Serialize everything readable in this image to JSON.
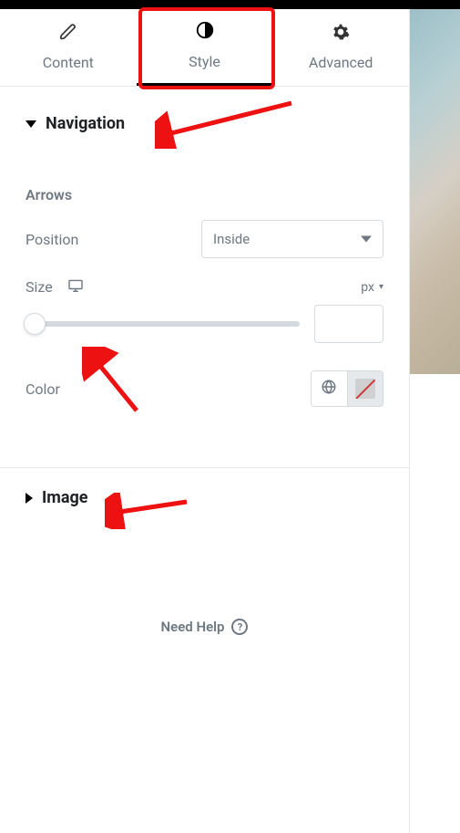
{
  "tabs": {
    "content": {
      "label": "Content"
    },
    "style": {
      "label": "Style",
      "active": true
    },
    "advanced": {
      "label": "Advanced"
    }
  },
  "sections": {
    "navigation": {
      "title": "Navigation",
      "expanded": true,
      "arrows": {
        "heading": "Arrows",
        "position": {
          "label": "Position",
          "value": "Inside"
        },
        "size": {
          "label": "Size",
          "unit": "px",
          "value": ""
        },
        "color": {
          "label": "Color"
        }
      }
    },
    "image": {
      "title": "Image",
      "expanded": false
    }
  },
  "help": {
    "label": "Need Help"
  }
}
